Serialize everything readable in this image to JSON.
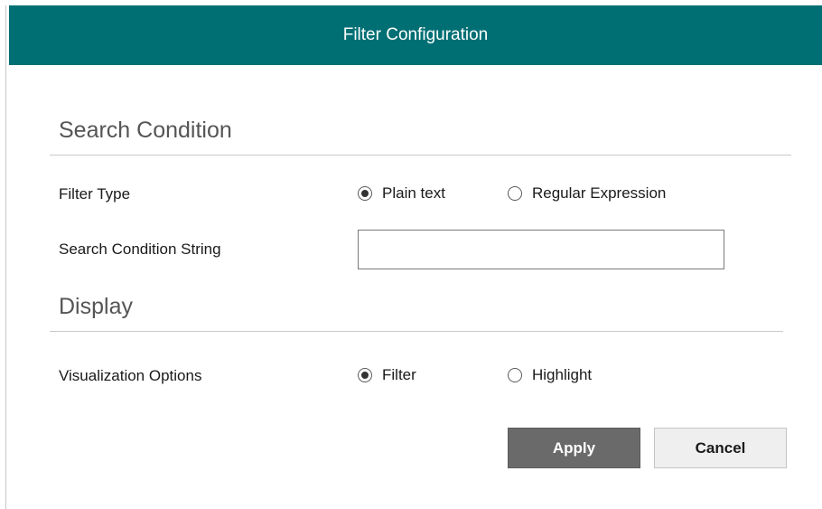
{
  "dialog": {
    "title": "Filter Configuration",
    "accent_color": "#006f74"
  },
  "search_condition": {
    "heading": "Search Condition",
    "filter_type": {
      "label": "Filter Type",
      "options": [
        "Plain text",
        "Regular Expression"
      ],
      "selected": "Plain text"
    },
    "search_string": {
      "label": "Search Condition String",
      "value": ""
    }
  },
  "display": {
    "heading": "Display",
    "visualization": {
      "label": "Visualization Options",
      "options": [
        "Filter",
        "Highlight"
      ],
      "selected": "Filter"
    }
  },
  "buttons": {
    "apply": "Apply",
    "cancel": "Cancel"
  }
}
